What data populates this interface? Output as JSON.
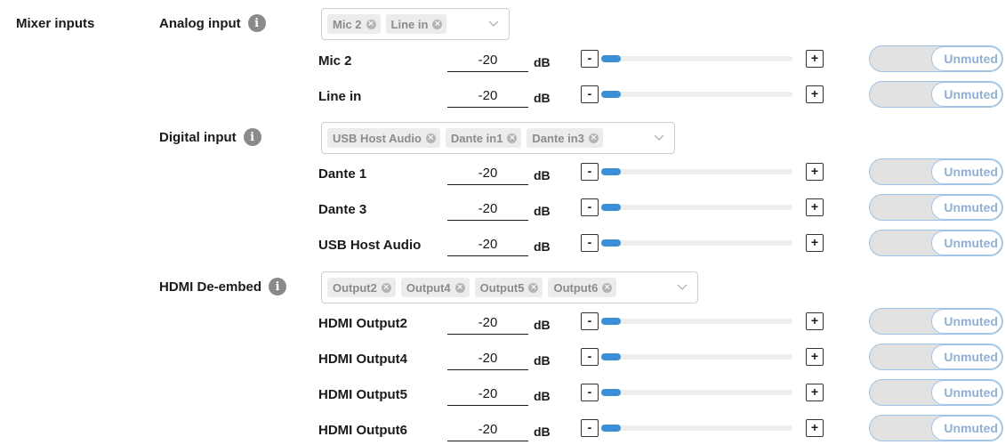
{
  "section_title": "Mixer inputs",
  "icons": {
    "info": "info-icon",
    "tag_remove": "close-circle-icon",
    "dropdown": "chevron-down-icon"
  },
  "colors": {
    "accent": "#3a8fd6",
    "toggle_border": "#9ec3e4",
    "toggle_text": "#8fb0d4",
    "tag_bg": "#ececec",
    "tag_text": "#8b8b8b"
  },
  "groups": [
    {
      "label": "Analog input",
      "selected": [
        "Mic 2",
        "Line in"
      ],
      "channels": [
        {
          "name": "Mic 2",
          "value": "-20",
          "unit": "dB",
          "level": 0.1,
          "mute_state": "Unmuted"
        },
        {
          "name": "Line in",
          "value": "-20",
          "unit": "dB",
          "level": 0.1,
          "mute_state": "Unmuted"
        }
      ]
    },
    {
      "label": "Digital input",
      "selected": [
        "USB Host Audio",
        "Dante in1",
        "Dante in3"
      ],
      "channels": [
        {
          "name": "Dante 1",
          "value": "-20",
          "unit": "dB",
          "level": 0.1,
          "mute_state": "Unmuted"
        },
        {
          "name": "Dante 3",
          "value": "-20",
          "unit": "dB",
          "level": 0.1,
          "mute_state": "Unmuted"
        },
        {
          "name": "USB Host Audio",
          "value": "-20",
          "unit": "dB",
          "level": 0.1,
          "mute_state": "Unmuted"
        }
      ]
    },
    {
      "label": "HDMI De-embed",
      "selected": [
        "Output2",
        "Output4",
        "Output5",
        "Output6"
      ],
      "channels": [
        {
          "name": "HDMI Output2",
          "value": "-20",
          "unit": "dB",
          "level": 0.1,
          "mute_state": "Unmuted"
        },
        {
          "name": "HDMI Output4",
          "value": "-20",
          "unit": "dB",
          "level": 0.1,
          "mute_state": "Unmuted"
        },
        {
          "name": "HDMI Output5",
          "value": "-20",
          "unit": "dB",
          "level": 0.1,
          "mute_state": "Unmuted"
        },
        {
          "name": "HDMI Output6",
          "value": "-20",
          "unit": "dB",
          "level": 0.1,
          "mute_state": "Unmuted"
        }
      ]
    }
  ],
  "controls": {
    "decrement": "-",
    "increment": "+"
  }
}
